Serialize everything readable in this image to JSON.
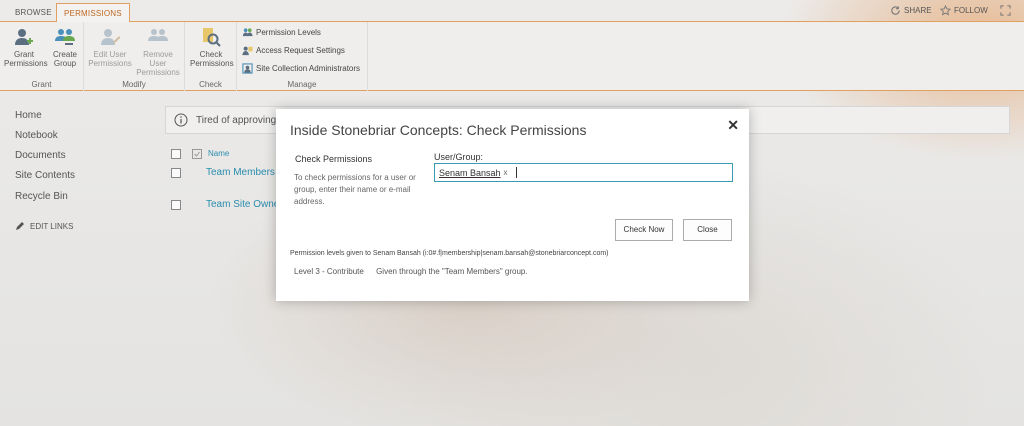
{
  "tabs": {
    "browse": "BROWSE",
    "permissions": "PERMISSIONS"
  },
  "topright": {
    "share": "SHARE",
    "follow": "FOLLOW"
  },
  "ribbon": {
    "grant": {
      "label": "Grant",
      "grant_permissions": "Grant Permissions",
      "create_group": "Create Group"
    },
    "modify": {
      "label": "Modify",
      "edit_user_permissions": "Edit User Permissions",
      "remove_user_permissions": "Remove User Permissions"
    },
    "check": {
      "label": "Check",
      "check_permissions": "Check Permissions"
    },
    "manage": {
      "label": "Manage",
      "permission_levels": "Permission Levels",
      "access_request_settings": "Access Request Settings",
      "site_collection_administrators": "Site Collection Administrators"
    }
  },
  "nav": {
    "items": [
      "Home",
      "Notebook",
      "Documents",
      "Site Contents",
      "Recycle Bin"
    ],
    "edit_links": "EDIT LINKS"
  },
  "notice": {
    "text": "Tired of approving"
  },
  "list": {
    "header": "Name",
    "rows": [
      "Team Members",
      "Team Site Owne"
    ]
  },
  "dialog": {
    "title": "Inside Stonebriar Concepts: Check Permissions",
    "section_title": "Check Permissions",
    "description": "To check permissions for a user or group, enter their name or e-mail address.",
    "user_group_label": "User/Group:",
    "chip": "Senam Bansah",
    "chip_remove": "x",
    "check_now": "Check Now",
    "close": "Close",
    "result_header": "Permission levels given to Senam Bansah (i:0#.f|membership|senam.bansah@stonebriarconcept.com)",
    "result_level": "Level 3 - Contribute",
    "result_source": "Given through the \"Team Members\" group."
  },
  "colors": {
    "accent": "#e0a060",
    "link": "#2a8dad",
    "field_border": "#3c9bb3"
  }
}
